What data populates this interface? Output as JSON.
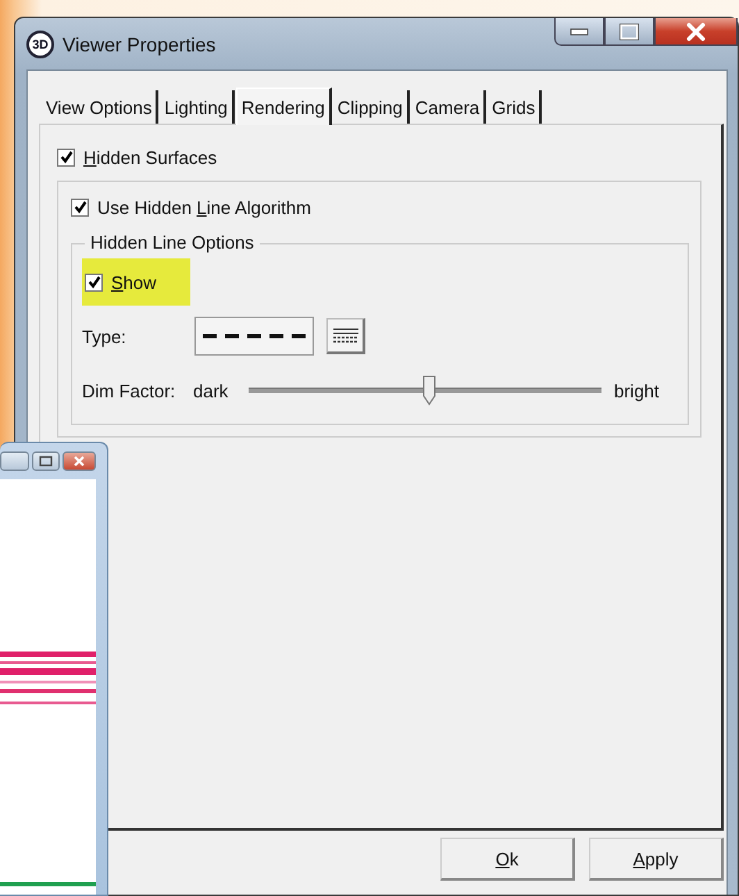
{
  "window": {
    "icon_label": "3D",
    "title": "Viewer Properties"
  },
  "tabs": [
    {
      "label": "View Options",
      "selected": false
    },
    {
      "label": "Lighting",
      "selected": false
    },
    {
      "label": "Rendering",
      "selected": true
    },
    {
      "label": "Clipping",
      "selected": false
    },
    {
      "label": "Camera",
      "selected": false
    },
    {
      "label": "Grids",
      "selected": false
    }
  ],
  "hidden_surfaces": {
    "label": {
      "key": "H",
      "after": "idden Surfaces"
    },
    "checked": true
  },
  "hidden_line_algorithm": {
    "label": {
      "before": "Use Hidden ",
      "key": "L",
      "after": "ine Algorithm"
    },
    "checked": true
  },
  "hidden_line_options": {
    "title": "Hidden Line Options",
    "show": {
      "label": {
        "key": "S",
        "after": "how"
      },
      "checked": true,
      "highlighted": true
    },
    "type_label": "Type:",
    "dim_factor": {
      "label": "Dim Factor:",
      "min_label": "dark",
      "max_label": "bright",
      "level": 0.51
    }
  },
  "buttons": [
    {
      "label": {
        "key": "O",
        "after": "k"
      }
    },
    {
      "label": {
        "key": "A",
        "after": "pply"
      }
    }
  ]
}
